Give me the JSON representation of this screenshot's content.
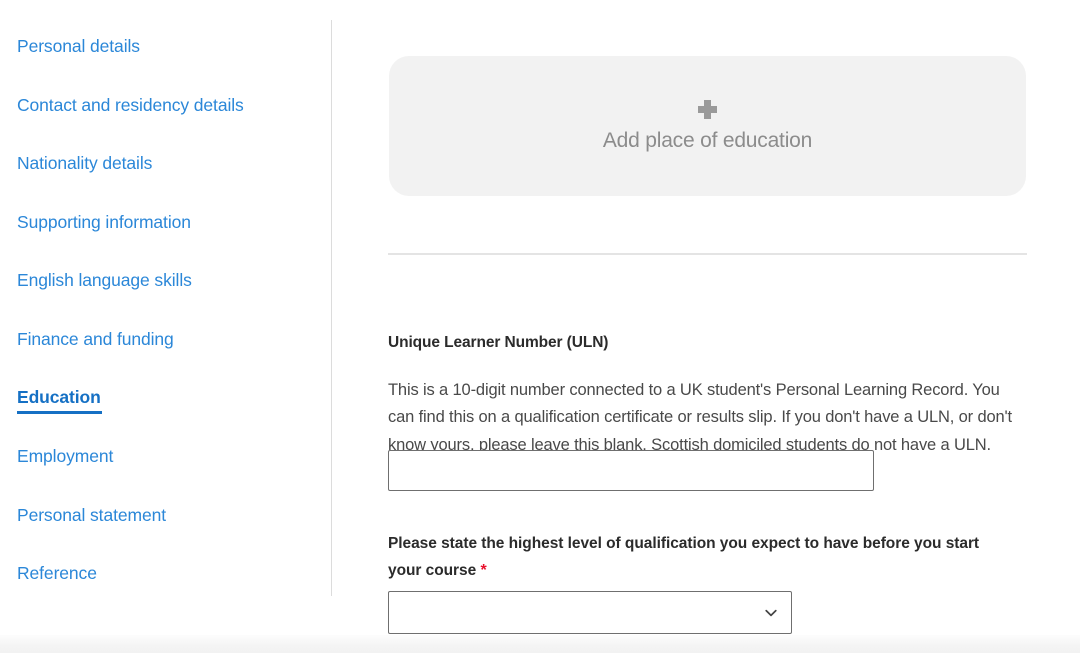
{
  "sidebar": {
    "items": [
      {
        "label": "Personal details",
        "active": false
      },
      {
        "label": "Contact and residency details",
        "active": false
      },
      {
        "label": "Nationality details",
        "active": false
      },
      {
        "label": "Supporting information",
        "active": false
      },
      {
        "label": "English language skills",
        "active": false
      },
      {
        "label": "Finance and funding",
        "active": false
      },
      {
        "label": "Education",
        "active": true
      },
      {
        "label": "Employment",
        "active": false
      },
      {
        "label": "Personal statement",
        "active": false
      },
      {
        "label": "Reference",
        "active": false
      }
    ]
  },
  "main": {
    "add_education_card": {
      "label": "Add place of education",
      "icon": "plus-icon"
    },
    "uln": {
      "heading": "Unique Learner Number (ULN)",
      "description": "This is a 10-digit number connected to a UK student's Personal Learning Record. You can find this on a qualification certificate or results slip. If you don't have a ULN, or don't know yours, please leave this blank. Scottish domiciled students do not have a ULN.",
      "input_value": "",
      "input_placeholder": ""
    },
    "qualification": {
      "label": "Please state the highest level of qualification you expect to have before you start your course",
      "required_marker": "*",
      "selected_value": "",
      "options": [
        ""
      ],
      "chevron_icon": "chevron-down-icon"
    }
  },
  "colors": {
    "link_blue": "#2b87d8",
    "active_blue": "#1570c4",
    "card_grey": "#f2f2f2",
    "required_red": "#e8112d",
    "heading_dark": "#2b2b2b",
    "body_grey": "#494949",
    "border_grey": "#6f6f6f",
    "divider_grey": "#e4e4e4"
  }
}
